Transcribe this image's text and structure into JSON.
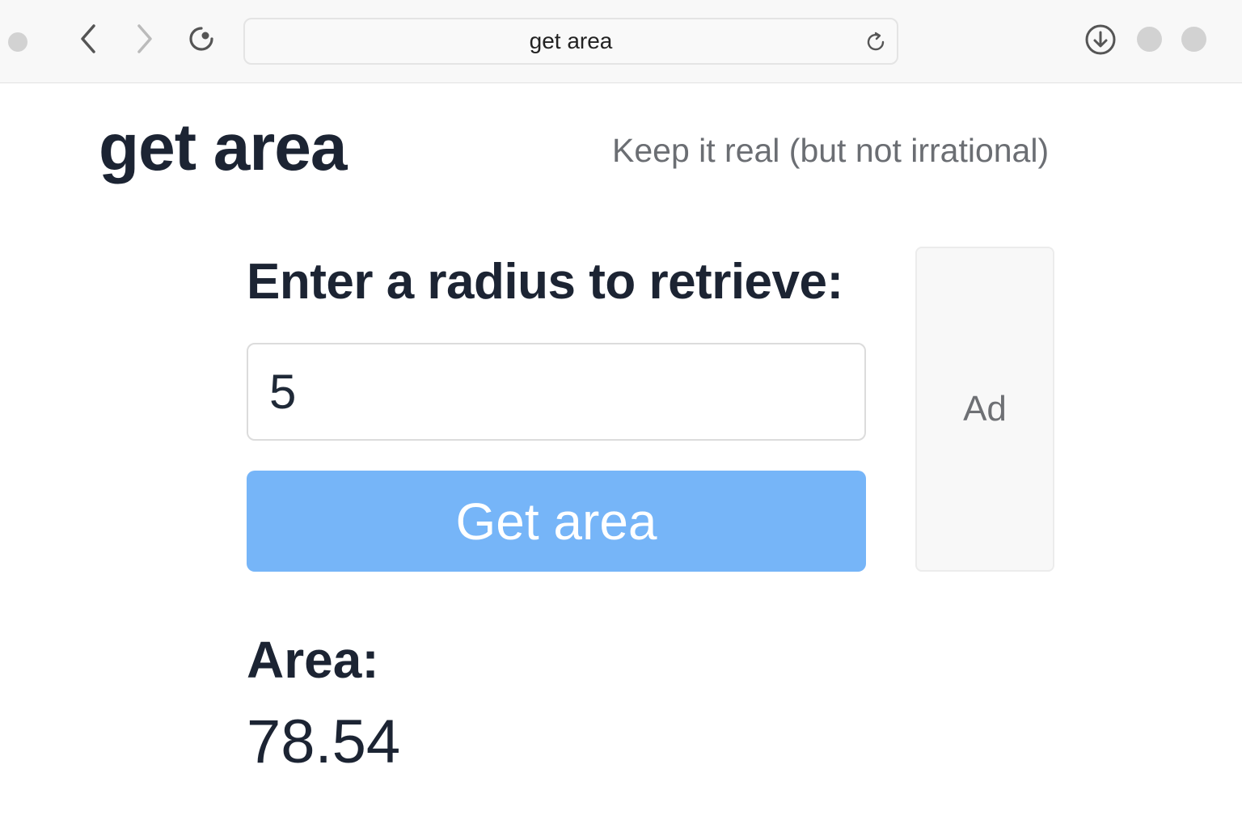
{
  "browser": {
    "address": "get area"
  },
  "header": {
    "title": "get area",
    "tagline": "Keep it real (but not irrational)"
  },
  "form": {
    "prompt": "Enter a radius to retrieve:",
    "radius_value": "5",
    "submit_label": "Get area"
  },
  "ad": {
    "label": "Ad"
  },
  "result": {
    "label": "Area:",
    "value": "78.54"
  },
  "colors": {
    "button": "#76b5f8",
    "title_text": "#1c2433",
    "tagline_text": "#6b6e73"
  },
  "icons": {
    "back": "chevron-left-icon",
    "forward": "chevron-right-icon",
    "reload": "reload-icon",
    "download": "download-icon"
  }
}
